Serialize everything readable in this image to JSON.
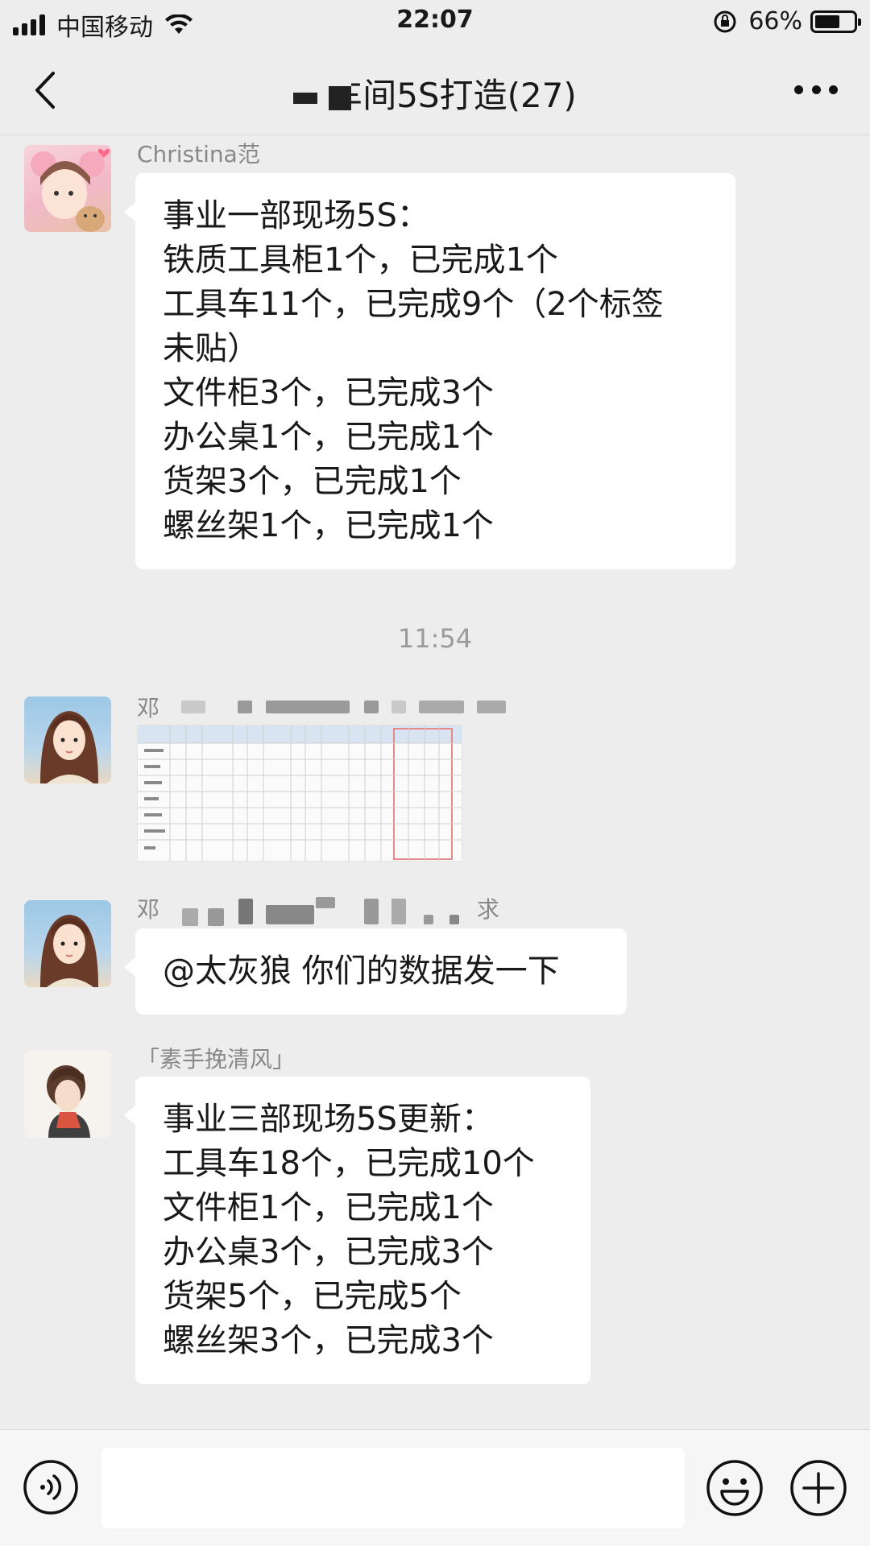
{
  "status": {
    "carrier": "中国移动",
    "time": "22:07",
    "battery": "66%",
    "battery_level": 0.66,
    "icons": [
      "signal-icon",
      "wifi-icon",
      "orientation-lock-icon",
      "battery-icon"
    ]
  },
  "header": {
    "title_visible": "间5S打造(27)",
    "title_partial": "车",
    "icons": [
      "back-arrow-icon",
      "more-icon"
    ]
  },
  "messages": [
    {
      "sender": "Christina范",
      "lines": [
        "事业一部现场5S：",
        "铁质工具柜1个，已完成1个",
        "工具车11个，已完成9个（2个标签",
        "未贴）",
        "文件柜3个，已完成3个",
        "办公桌1个，已完成1个",
        "货架3个，已完成1个",
        "螺丝架1个，已完成1个"
      ]
    },
    {
      "timestamp": "11:54"
    },
    {
      "sender_visible": "邓",
      "type": "image"
    },
    {
      "sender_visible": "邓",
      "sender_tail": "求",
      "lines": [
        "@太灰狼 你们的数据发一下"
      ]
    },
    {
      "sender": "「素手挽清风」",
      "lines": [
        "事业三部现场5S更新：",
        "工具车18个，已完成10个",
        "文件柜1个，已完成1个",
        "办公桌3个，已完成3个",
        "货架5个，已完成5个",
        "螺丝架3个，已完成3个"
      ]
    }
  ],
  "input_bar": {
    "placeholder": "",
    "icons": [
      "voice-icon",
      "emoji-icon",
      "plus-icon"
    ]
  }
}
